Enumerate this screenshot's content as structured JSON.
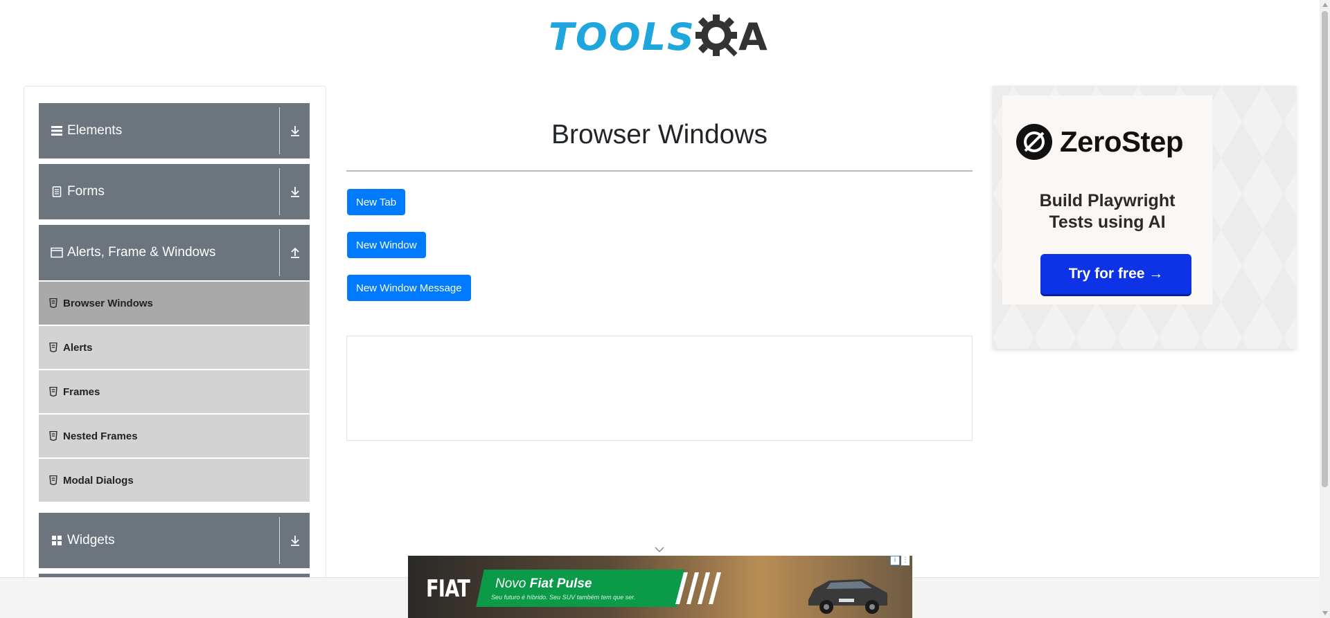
{
  "header": {
    "logo_text_blue": "TOOLS",
    "logo_text_dark": "A"
  },
  "sidebar": {
    "groups": [
      {
        "label": "Elements",
        "icon": "hamburger-icon",
        "expanded": false
      },
      {
        "label": "Forms",
        "icon": "document-icon",
        "expanded": false
      },
      {
        "label": "Alerts, Frame & Windows",
        "icon": "window-icon",
        "expanded": true
      },
      {
        "label": "Widgets",
        "icon": "grid-icon",
        "expanded": false
      }
    ],
    "items": [
      {
        "label": "Browser Windows",
        "active": true
      },
      {
        "label": "Alerts",
        "active": false
      },
      {
        "label": "Frames",
        "active": false
      },
      {
        "label": "Nested Frames",
        "active": false
      },
      {
        "label": "Modal Dialogs",
        "active": false
      }
    ]
  },
  "main": {
    "title": "Browser Windows",
    "buttons": {
      "new_tab": "New Tab",
      "new_window": "New Window",
      "new_window_message": "New Window Message"
    }
  },
  "ad_right": {
    "brand": "ZeroStep",
    "tagline_line1": "Build Playwright",
    "tagline_line2": "Tests using AI",
    "cta": "Try for free →"
  },
  "ad_bottom": {
    "logo": "FIAT",
    "headline_prefix": "Novo ",
    "headline_bold": "Fiat Pulse",
    "subtext": "Seu futuro é híbrido. Seu SUV também tem que ser."
  },
  "colors": {
    "primary_button": "#007bff",
    "group_header": "#6c757d",
    "menu_item": "#d3d3d3",
    "menu_item_active": "#a9a9a9",
    "logo_blue": "#1ea6dd",
    "cta_blue": "#0e32e5"
  }
}
